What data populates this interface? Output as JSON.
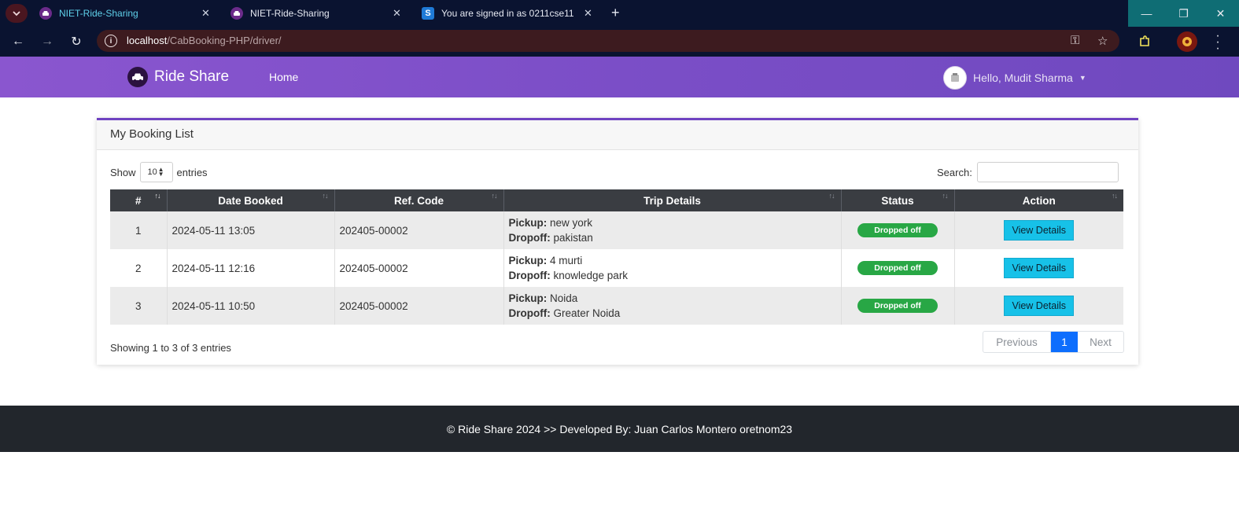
{
  "browser": {
    "tabs": [
      {
        "title": "NIET-Ride-Sharing",
        "active": true
      },
      {
        "title": "NIET-Ride-Sharing",
        "active": false
      },
      {
        "title": "You are signed in as 0211cse11",
        "active": false
      }
    ],
    "url_host": "localhost",
    "url_path": "/CabBooking-PHP/driver/",
    "icons": {
      "tab_menu": "chevron-down-icon",
      "close": "close-icon",
      "new_tab": "plus-icon",
      "back": "arrow-left-icon",
      "forward": "arrow-right-icon",
      "reload": "reload-icon",
      "site_info": "info-icon",
      "password": "key-icon",
      "bookmark": "star-icon",
      "extensions": "puzzle-icon",
      "profile": "profile-icon",
      "menu": "kebab-icon"
    }
  },
  "navbar": {
    "brand": "Ride Share",
    "home": "Home",
    "user_greeting": "Hello, Mudit Sharma"
  },
  "card": {
    "title": "My Booking List",
    "show_label": "Show",
    "entries_value": "10",
    "entries_label": "entries",
    "search_label": "Search:",
    "search_value": ""
  },
  "table": {
    "headers": [
      "#",
      "Date Booked",
      "Ref. Code",
      "Trip Details",
      "Status",
      "Action"
    ],
    "pickup_label": "Pickup:",
    "dropoff_label": "Dropoff:",
    "rows": [
      {
        "num": "1",
        "date": "2024-05-11 13:05",
        "ref": "202405-00002",
        "pickup": "new york",
        "dropoff": "pakistan",
        "status": "Dropped off",
        "action": "View Details"
      },
      {
        "num": "2",
        "date": "2024-05-11 12:16",
        "ref": "202405-00002",
        "pickup": "4 murti",
        "dropoff": "knowledge park",
        "status": "Dropped off",
        "action": "View Details"
      },
      {
        "num": "3",
        "date": "2024-05-11 10:50",
        "ref": "202405-00002",
        "pickup": "Noida",
        "dropoff": "Greater Noida",
        "status": "Dropped off",
        "action": "View Details"
      }
    ]
  },
  "pagination": {
    "info": "Showing 1 to 3 of 3 entries",
    "previous": "Previous",
    "current": "1",
    "next": "Next"
  },
  "footer": {
    "text": "© Ride Share 2024 >> Developed By: Juan Carlos Montero oretnom23"
  },
  "colors": {
    "navbar": "#7b4ec7",
    "badge_success": "#28a745",
    "btn_info": "#17c1e8",
    "page_active": "#0d6efd",
    "footer": "#22262c"
  }
}
